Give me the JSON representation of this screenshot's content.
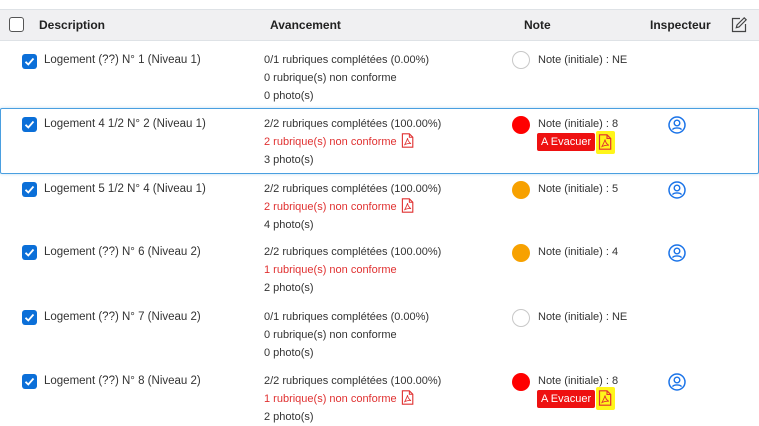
{
  "header": {
    "description": "Description",
    "avancement": "Avancement",
    "note": "Note",
    "inspecteur": "Inspecteur"
  },
  "colors": {
    "accent": "#0b6fd8",
    "danger": "#e03131",
    "warning": "#f7a100",
    "highlight": "#fff51a"
  },
  "rows": [
    {
      "checked": true,
      "description": "Logement (??) N° 1 (Niveau 1)",
      "progress": "0/1 rubriques complétées (0.00%)",
      "nonconform": "0 rubrique(s) non conforme",
      "photos": "0 photo(s)",
      "note": "Note (initiale) : NE",
      "note_color": "none"
    },
    {
      "checked": true,
      "description": "Logement 4 1/2 N° 2 (Niveau 1)",
      "progress": "2/2 rubriques complétées (100.00%)",
      "nonconform": "2 rubrique(s) non conforme",
      "photos": "3 photo(s)",
      "note": "Note (initiale) : 8",
      "note_color": "red",
      "badge": "A Evacuer"
    },
    {
      "checked": true,
      "description": "Logement 5 1/2 N° 4 (Niveau 1)",
      "progress": "2/2 rubriques complétées (100.00%)",
      "nonconform": "2 rubrique(s) non conforme",
      "photos": "4 photo(s)",
      "note": "Note (initiale) : 5",
      "note_color": "orange"
    },
    {
      "checked": true,
      "description": "Logement (??) N° 6 (Niveau 2)",
      "progress": "2/2 rubriques complétées (100.00%)",
      "nonconform": "1 rubrique(s) non conforme",
      "photos": "2 photo(s)",
      "note": "Note (initiale) : 4",
      "note_color": "orange"
    },
    {
      "checked": true,
      "description": "Logement (??) N° 7 (Niveau 2)",
      "progress": "0/1 rubriques complétées (0.00%)",
      "nonconform": "0 rubrique(s) non conforme",
      "photos": "0 photo(s)",
      "note": "Note (initiale) : NE",
      "note_color": "none"
    },
    {
      "checked": true,
      "description": "Logement (??) N° 8 (Niveau 2)",
      "progress": "2/2 rubriques complétées (100.00%)",
      "nonconform": "1 rubrique(s) non conforme",
      "photos": "2 photo(s)",
      "note": "Note (initiale) : 8",
      "note_color": "red",
      "badge": "A Evacuer"
    }
  ]
}
